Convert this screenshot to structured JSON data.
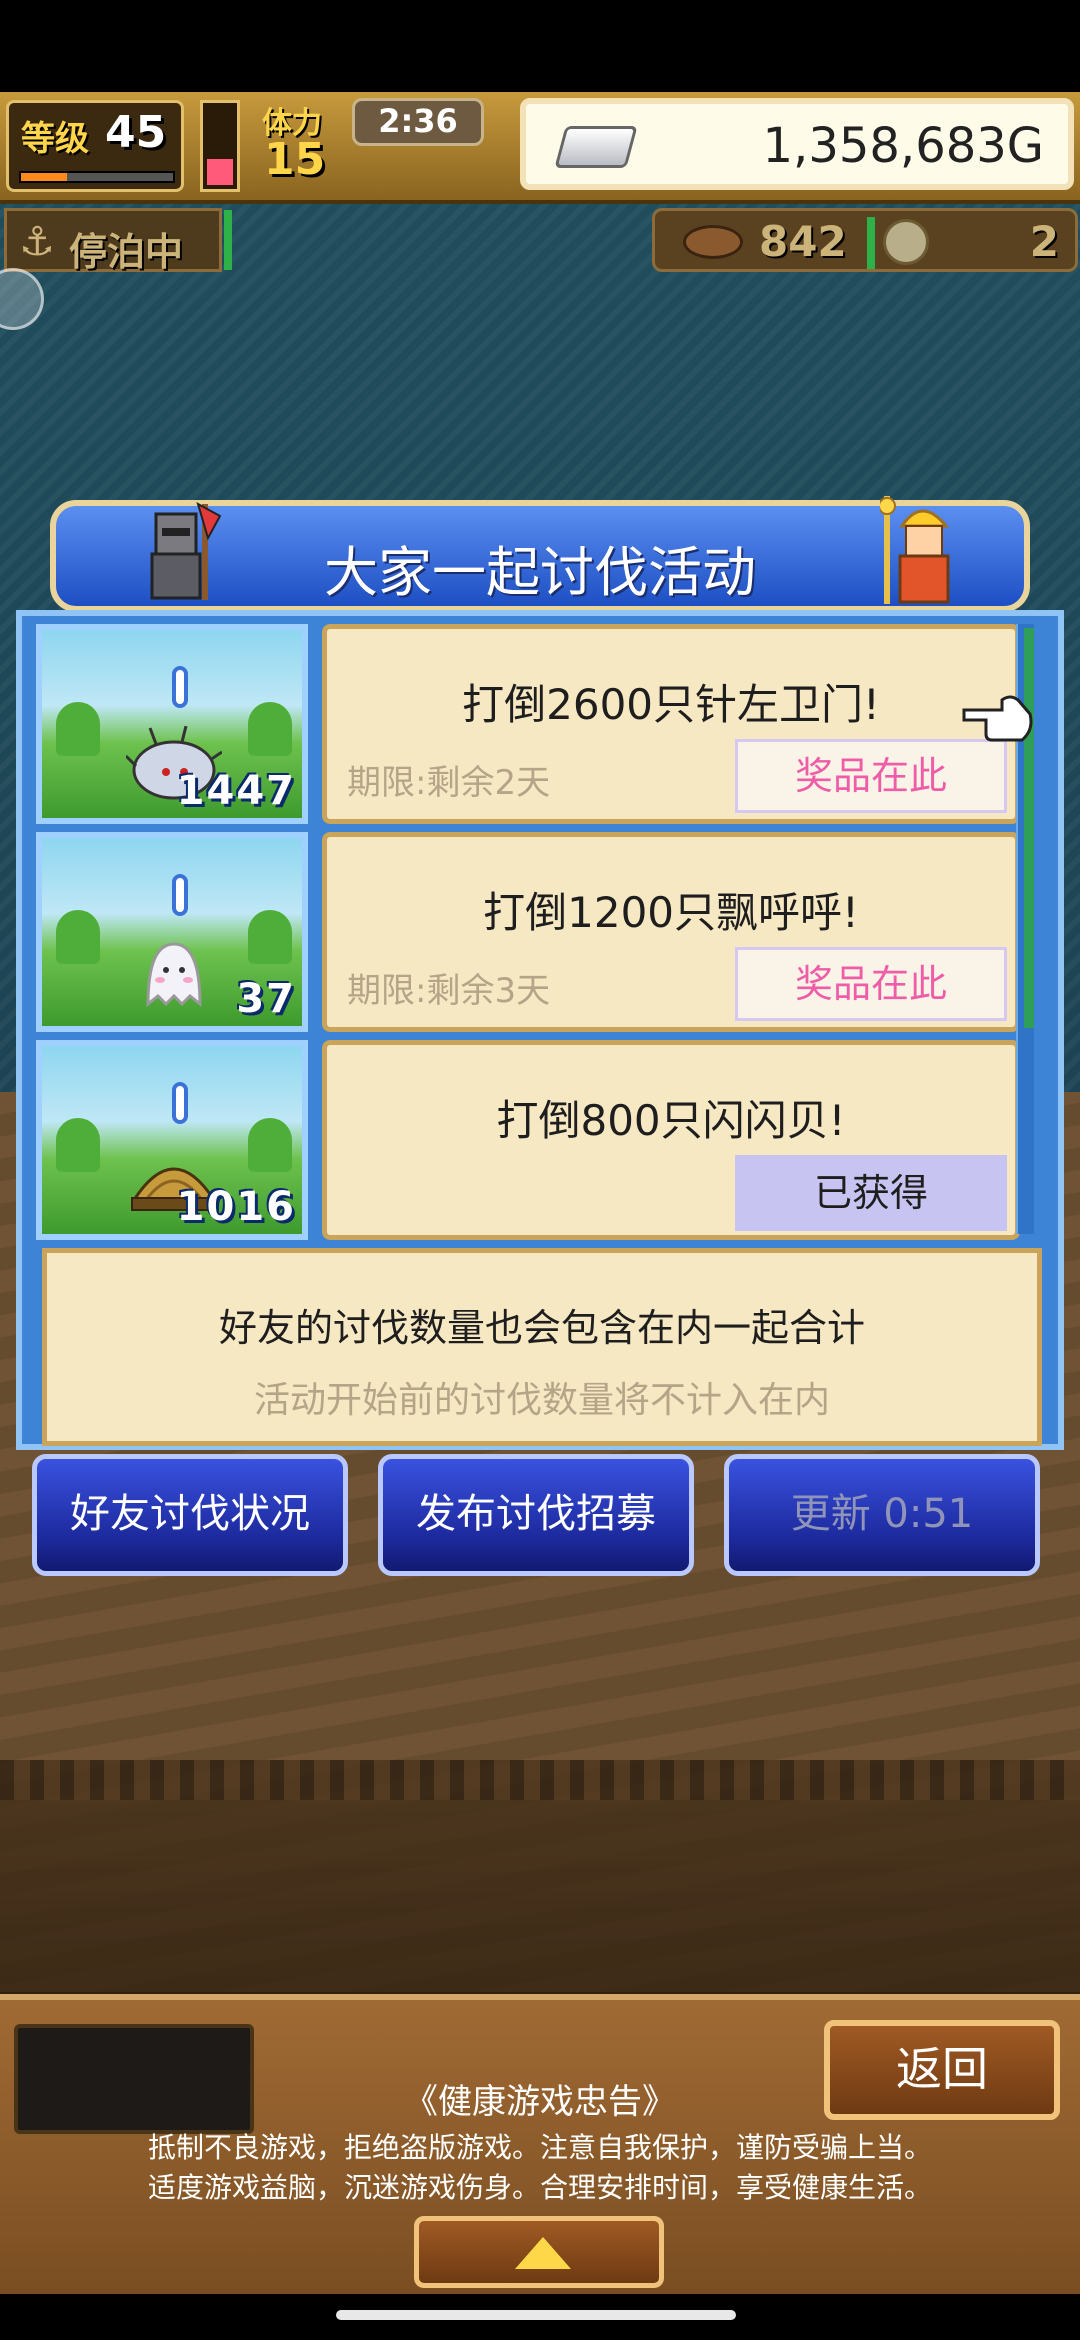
{
  "hud": {
    "level_label": "等级",
    "level": "45",
    "level_progress": 0.3,
    "hp_fill": 0.3,
    "stamina_label": "体力",
    "stamina": "15",
    "timer": "2:36",
    "gold": "1,358,683G",
    "dock_status": "停泊中",
    "resource1": "842",
    "resource2": "2"
  },
  "dialog": {
    "title": "大家一起讨伐活动",
    "quests": [
      {
        "title": "打倒2600只针左卫门!",
        "deadline": "期限:剩余2天",
        "reward_label": "奖品在此",
        "count": "1447",
        "monster": "urchin"
      },
      {
        "title": "打倒1200只飘呼呼!",
        "deadline": "期限:剩余3天",
        "reward_label": "奖品在此",
        "count": "37",
        "monster": "ghost"
      },
      {
        "title": "打倒800只闪闪贝!",
        "deadline": "",
        "reward_label": "已获得",
        "count": "1016",
        "monster": "shell"
      }
    ],
    "note_main": "好友的讨伐数量也会包含在内一起合计",
    "note_sub": "活动开始前的讨伐数量将不计入在内"
  },
  "actions": {
    "friend_status": "好友讨伐状况",
    "post_recruit": "发布讨伐招募",
    "refresh": "更新 0:51"
  },
  "bottom": {
    "back_label": "返回",
    "notice_title": "《健康游戏忠告》",
    "notice_line1": "抵制不良游戏，拒绝盗版游戏。注意自我保护，谨防受骗上当。",
    "notice_line2": "适度游戏益脑，沉迷游戏伤身。合理安排时间，享受健康生活。"
  },
  "colors": {
    "reward_text": "#ef5da8",
    "panel_blue": "#3d84d6",
    "card_bg": "#f7e8c4"
  }
}
